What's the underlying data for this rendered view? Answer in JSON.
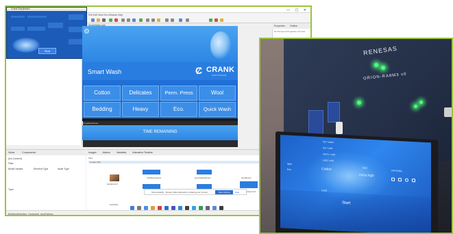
{
  "ide": {
    "title": "Crank Designer",
    "menu": "File  Edit  View  Run  Window  Help",
    "editor_tab": "SmartWash.gde",
    "editor_subtab": "screen",
    "properties_tab": "Properties",
    "outline_tab": "Outline",
    "properties_empty": "No Document Properties. No Sele",
    "views_tab": "Views",
    "components_tab": "Components",
    "views_filter": "Filter",
    "views_current": "(No Context)",
    "views_columns": [
      "Model Variant",
      "Element Type",
      "Node Type"
    ],
    "views_section": "Type",
    "images_tabs": [
      "Images",
      "Actions",
      "Variables",
      "Animation Timeline"
    ],
    "images_filter": "Filter",
    "images_folder": "images (36)",
    "images": [
      {
        "label": "background"
      },
      {
        "label": "TitleBarShadow"
      },
      {
        "label": "QuickWashButton"
      },
      {
        "label": "backButton"
      },
      {
        "label": "TitleBarShadow"
      },
      {
        "label": "ButtonPress"
      },
      {
        "label": "BeddingBackground"
      },
      {
        "label": "bedTable"
      }
    ],
    "share_text": "Screencastify - Screen Video Recorder is sharing your screen.",
    "share_button": "Stop sharing",
    "share_hide": "Hide",
    "status": "BeddingSelection_Horizontal_dropFabrics",
    "separator_label": "CompleteScreen"
  },
  "preview": {
    "title": "Crank Storyboard",
    "start": "Start"
  },
  "app": {
    "title": "Smart Wash",
    "brand": "CRANK",
    "brand_sub": "SOFTWARE",
    "cycles": [
      "Cotton",
      "Delicates",
      "Perm. Press",
      "Wool",
      "Bedding",
      "Heavy",
      "Eco.",
      "Quick Wash"
    ],
    "time_remaining": "TIME REMAINING"
  },
  "device": {
    "board_brand": "RENESAS",
    "board_model": "ORION-RA8M3 v0",
    "lcd": {
      "start": "Start",
      "temps": [
        "hot / warm",
        "hot / cold",
        "warm / cold",
        "cold / cold"
      ],
      "cycle": "Cotton",
      "left": [
        "Spin",
        "Eco"
      ],
      "spin": [
        "Spin",
        "extra high"
      ],
      "options_label": "OPTIONS",
      "water_label": "Load"
    }
  },
  "colors": {
    "ide_border": "#9ac43a",
    "app_blue": "#2a7de0",
    "cycle_button": "#3b8ee8",
    "led_green": "#4dff7a"
  }
}
